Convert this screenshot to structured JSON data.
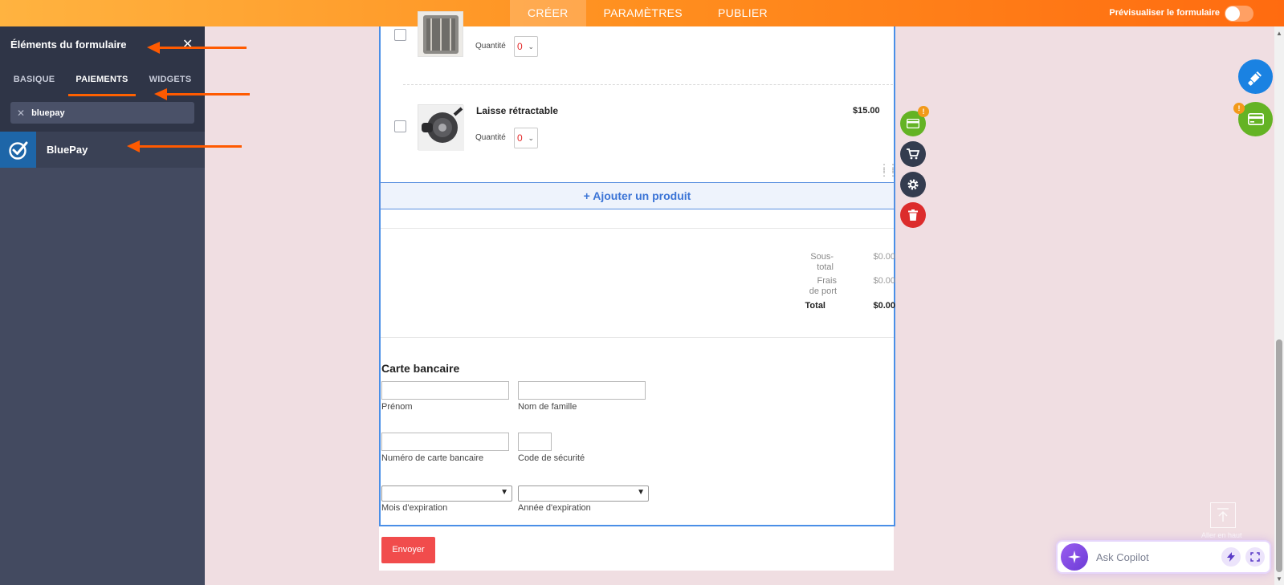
{
  "topbar": {
    "tabs": [
      {
        "label": "CRÉER",
        "active": true
      },
      {
        "label": "PARAMÈTRES",
        "active": false
      },
      {
        "label": "PUBLIER",
        "active": false
      }
    ],
    "preview_label": "Prévisualiser le formulaire"
  },
  "left_panel": {
    "title": "Éléments du formulaire",
    "close_label": "✕",
    "tabs": [
      "BASIQUE",
      "PAIEMENTS",
      "WIDGETS"
    ],
    "active_tab": "PAIEMENTS",
    "search_value": "bluepay",
    "results": [
      {
        "label": "BluePay",
        "icon": "bluepay-check-icon"
      }
    ]
  },
  "products": [
    {
      "name": "",
      "price": "",
      "qty_label": "Quantité",
      "qty_value": "0"
    },
    {
      "name": "Laisse rétractable",
      "price": "$15.00",
      "qty_label": "Quantité",
      "qty_value": "0"
    }
  ],
  "add_product_label": "+ Ajouter un produit",
  "summary": {
    "subtotal_label_1": "Sous-",
    "subtotal_label_2": "total",
    "subtotal_value": "$0.00",
    "shipping_label_1": "Frais",
    "shipping_label_2": "de port",
    "shipping_value": "$0.00",
    "total_label": "Total",
    "total_value": "$0.00"
  },
  "credit_card": {
    "title": "Carte bancaire",
    "first_name_label": "Prénom",
    "last_name_label": "Nom de famille",
    "card_number_label": "Numéro de carte bancaire",
    "security_code_label": "Code de sécurité",
    "exp_month_label": "Mois d'expiration",
    "exp_year_label": "Année d'expiration"
  },
  "submit_label": "Envoyer",
  "side_tools": [
    "payment-icon",
    "cart-icon",
    "gear-icon",
    "trash-icon"
  ],
  "back_to_top_label": "Aller en haut",
  "copilot": {
    "placeholder": "Ask Copilot"
  },
  "colors": {
    "accent_orange": "#ff6b10",
    "panel_dark": "#2f3547",
    "panel": "#434a60",
    "form_border": "#4a8fe7",
    "submit_red": "#f14c4c",
    "tool_green": "#64b324",
    "tool_red": "#dc2c2c",
    "tool_dark": "#343c4f",
    "brush_blue": "#1a82e2"
  }
}
